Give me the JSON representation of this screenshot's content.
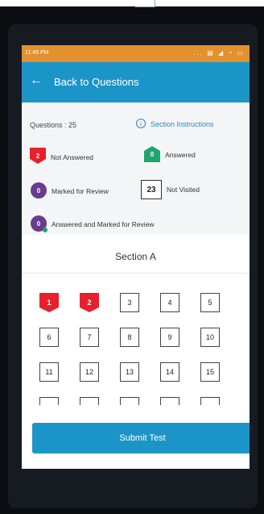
{
  "status_bar": {
    "time": "11:49 PM",
    "icons": "... ▤ ◢ ◔ ▭"
  },
  "app_bar": {
    "back_icon": "arrow-left",
    "title": "Back to Questions"
  },
  "legend": {
    "questions_label": "Questions : 25",
    "section_instructions": "Section Instructions",
    "not_answered": {
      "count": "2",
      "label": "Not Answered"
    },
    "answered": {
      "count": "0",
      "label": "Answered"
    },
    "marked_for_review": {
      "count": "0",
      "label": "Marked for Review"
    },
    "not_visited": {
      "count": "23",
      "label": "Not Visited"
    },
    "answered_and_marked": {
      "count": "0",
      "label": "Answered and Marked for Review"
    }
  },
  "section": {
    "title": "Section A",
    "questions": [
      {
        "n": "1",
        "state": "not_answered"
      },
      {
        "n": "2",
        "state": "not_answered"
      },
      {
        "n": "3",
        "state": "not_visited"
      },
      {
        "n": "4",
        "state": "not_visited"
      },
      {
        "n": "5",
        "state": "not_visited"
      },
      {
        "n": "6",
        "state": "not_visited"
      },
      {
        "n": "7",
        "state": "not_visited"
      },
      {
        "n": "8",
        "state": "not_visited"
      },
      {
        "n": "9",
        "state": "not_visited"
      },
      {
        "n": "10",
        "state": "not_visited"
      },
      {
        "n": "11",
        "state": "not_visited"
      },
      {
        "n": "12",
        "state": "not_visited"
      },
      {
        "n": "13",
        "state": "not_visited"
      },
      {
        "n": "14",
        "state": "not_visited"
      },
      {
        "n": "15",
        "state": "not_visited"
      },
      {
        "n": "",
        "state": "not_visited"
      },
      {
        "n": "",
        "state": "not_visited"
      },
      {
        "n": "",
        "state": "not_visited"
      },
      {
        "n": "",
        "state": "not_visited"
      },
      {
        "n": "",
        "state": "not_visited"
      }
    ]
  },
  "submit_label": "Submit Test",
  "colors": {
    "appbar": "#1b95c8",
    "statusbar": "#e3912e",
    "not_answered": "#e8202c",
    "answered": "#1fa56e",
    "review": "#6a3b8f"
  }
}
